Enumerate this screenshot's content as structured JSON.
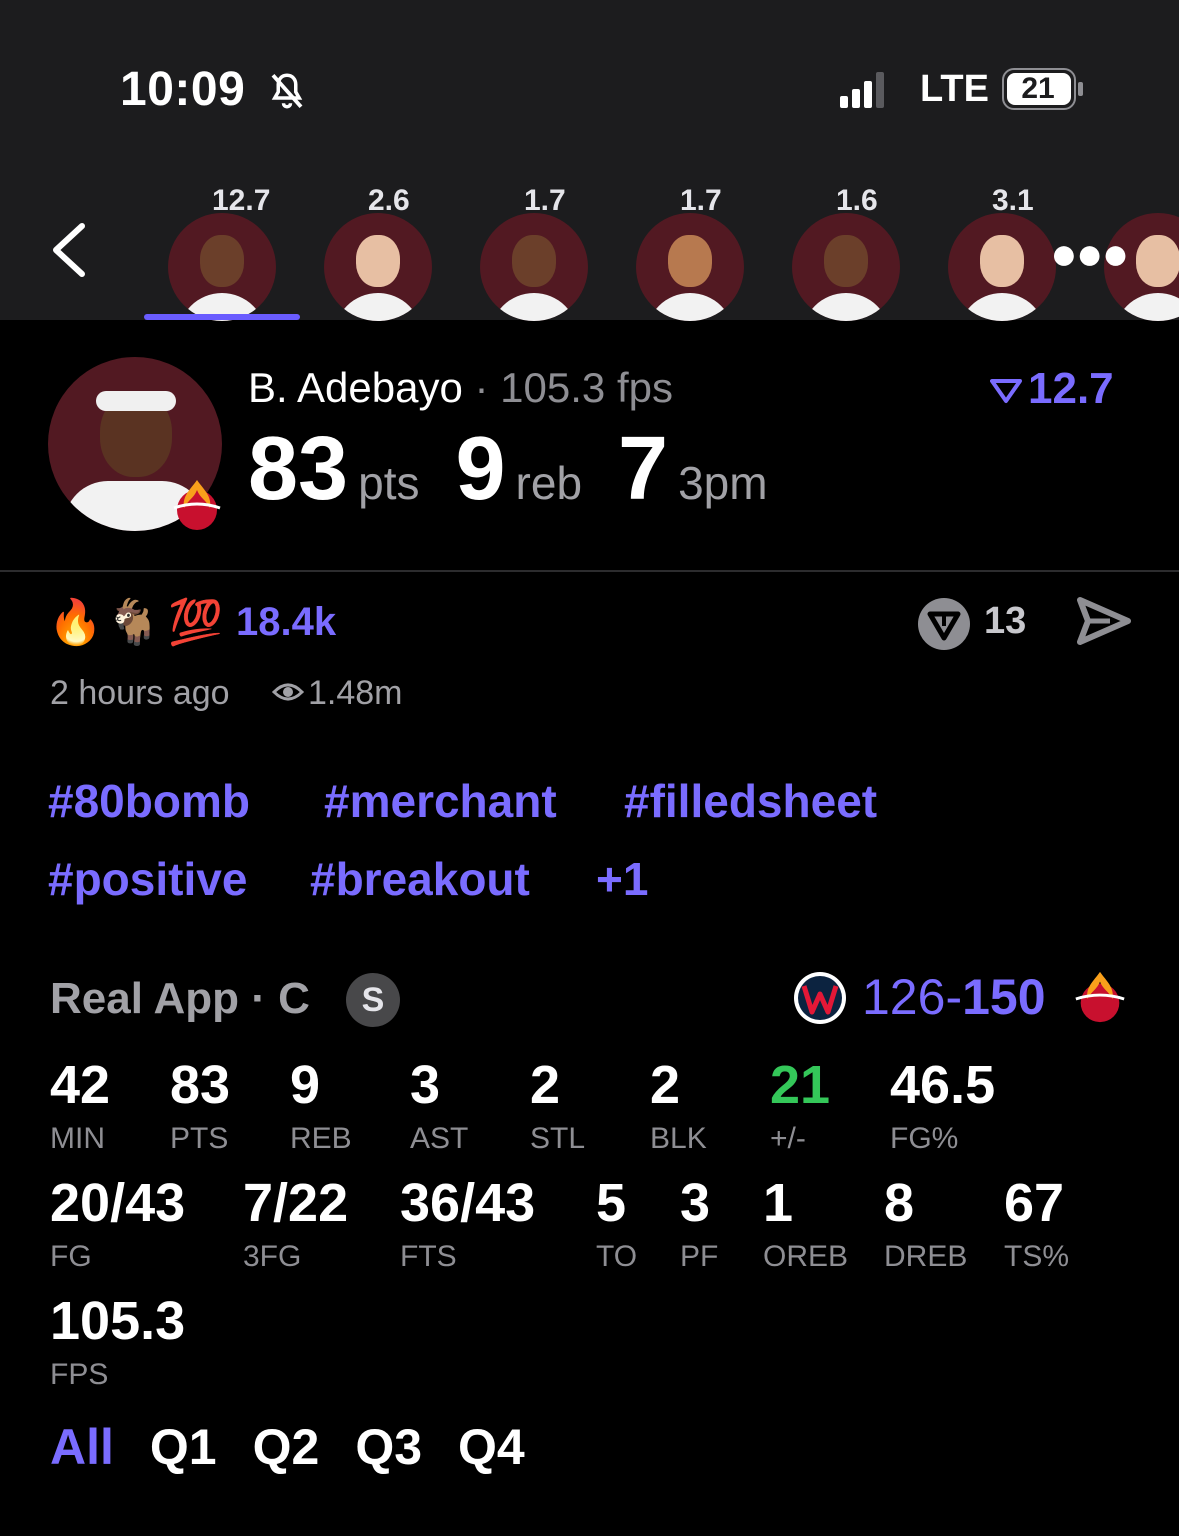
{
  "status_bar": {
    "time": "10:09",
    "network": "LTE",
    "battery": "21"
  },
  "roster": {
    "players": [
      {
        "value": "12.7"
      },
      {
        "value": "2.6"
      },
      {
        "value": "1.7"
      },
      {
        "value": "1.7"
      },
      {
        "value": "1.6"
      },
      {
        "value": "3.1"
      }
    ]
  },
  "player": {
    "name": "B. Adebayo",
    "fps_label": "· 105.3 fps",
    "rank_value": "12.7",
    "pts": "83",
    "pts_unit": "pts",
    "reb": "9",
    "reb_unit": "reb",
    "tpm": "7",
    "tpm_unit": "3pm"
  },
  "post": {
    "reaction_emojis": [
      "🔥",
      "🐐",
      "💯"
    ],
    "reaction_count": "18.4k",
    "comment_count": "13",
    "time_ago": "2 hours ago",
    "views": "1.48m",
    "tags": [
      "#80bomb",
      "#merchant",
      "#filledsheet",
      "#positive",
      "#breakout",
      "+1"
    ]
  },
  "game": {
    "league_label": "Real App · C",
    "badge": "S",
    "score_away": "126",
    "score_sep": "-",
    "score_home": "150"
  },
  "stats": [
    {
      "value": "42",
      "label": "MIN"
    },
    {
      "value": "83",
      "label": "PTS"
    },
    {
      "value": "9",
      "label": "REB"
    },
    {
      "value": "3",
      "label": "AST"
    },
    {
      "value": "2",
      "label": "STL"
    },
    {
      "value": "2",
      "label": "BLK"
    },
    {
      "value": "21",
      "label": "+/-"
    },
    {
      "value": "46.5",
      "label": "FG%"
    },
    {
      "value": "20/43",
      "label": "FG"
    },
    {
      "value": "7/22",
      "label": "3FG"
    },
    {
      "value": "36/43",
      "label": "FTS"
    },
    {
      "value": "5",
      "label": "TO"
    },
    {
      "value": "3",
      "label": "PF"
    },
    {
      "value": "1",
      "label": "OREB"
    },
    {
      "value": "8",
      "label": "DREB"
    },
    {
      "value": "67",
      "label": "TS%"
    },
    {
      "value": "105.3",
      "label": "FPS"
    }
  ],
  "quarters": [
    "All",
    "Q1",
    "Q2",
    "Q3",
    "Q4"
  ],
  "colors": {
    "accent": "#7a6cff",
    "positive": "#34c759",
    "team": "#521922"
  }
}
